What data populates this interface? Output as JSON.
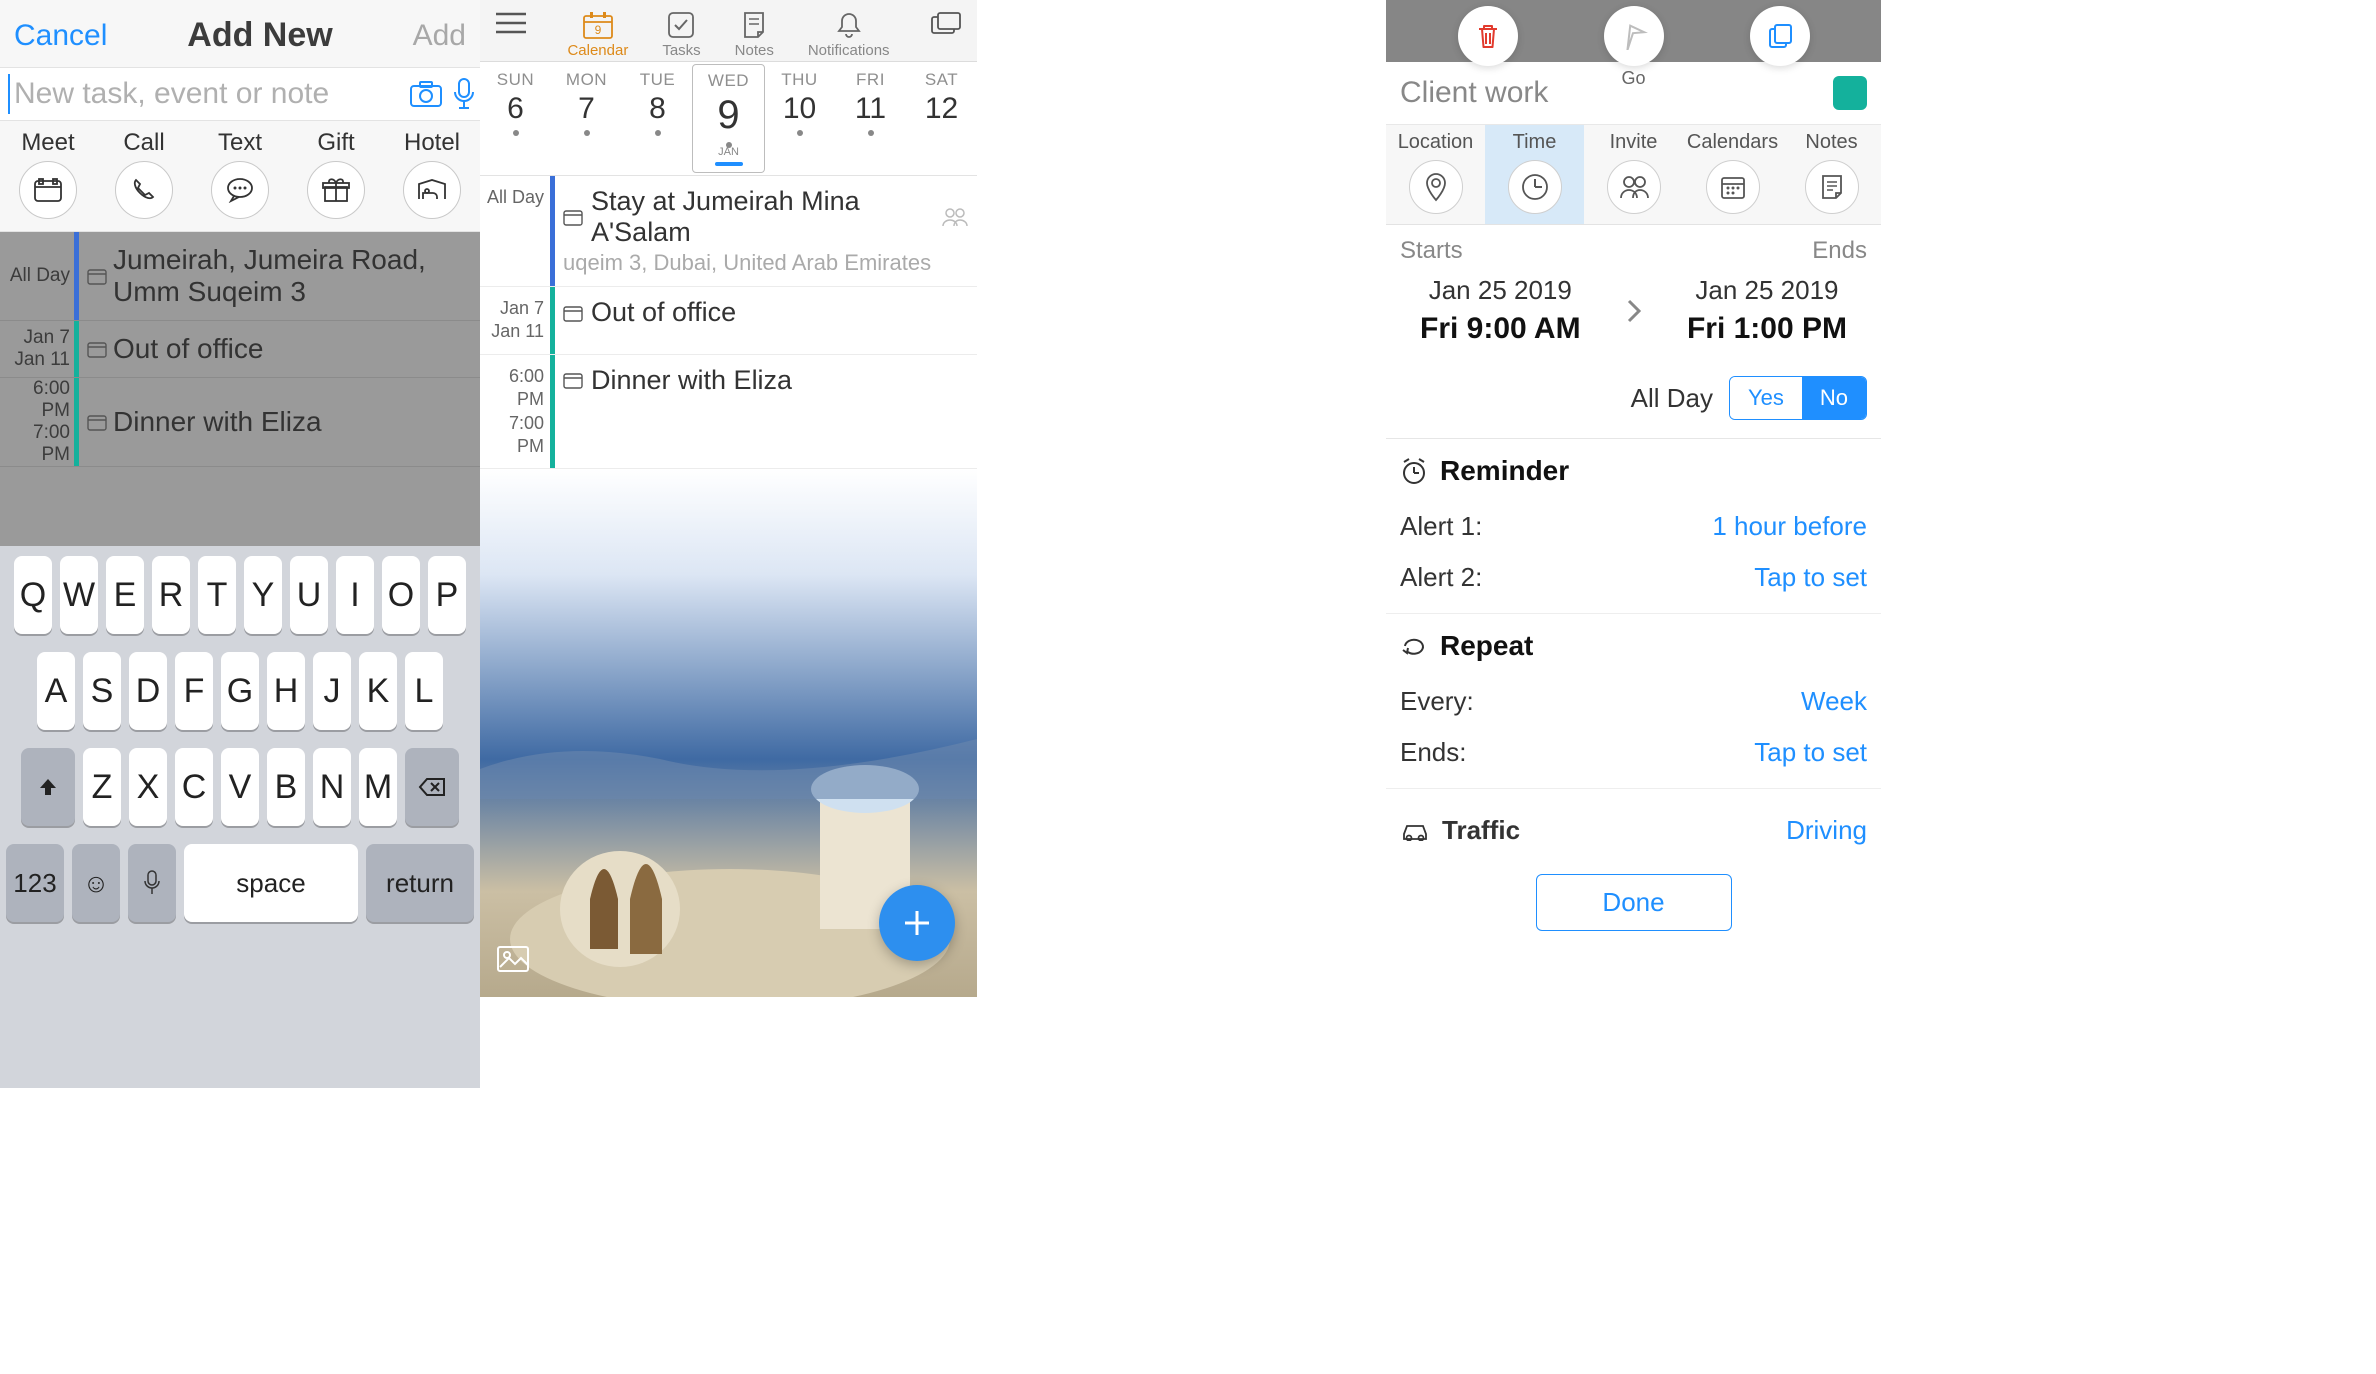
{
  "pane1": {
    "cancel": "Cancel",
    "title": "Add New",
    "add": "Add",
    "placeholder": "New task, event or note",
    "quick": [
      {
        "label": "Meet",
        "icon": "meet-icon"
      },
      {
        "label": "Call",
        "icon": "phone-icon"
      },
      {
        "label": "Text",
        "icon": "chat-icon"
      },
      {
        "label": "Gift",
        "icon": "gift-icon"
      },
      {
        "label": "Hotel",
        "icon": "hotel-icon"
      }
    ],
    "bg_events": [
      {
        "time_label": "All Day",
        "bar": "#3a6fd8",
        "title": "Jumeirah, Jumeira Road, Umm Suqeim 3"
      },
      {
        "time_top": "Jan 7",
        "time_bot": "Jan 11",
        "bar": "#14b19c",
        "title": "Out of office"
      },
      {
        "time_top": "6:00 PM",
        "time_bot": "7:00 PM",
        "bar": "#14b19c",
        "title": "Dinner with Eliza"
      }
    ],
    "keyboard": {
      "row1": [
        "Q",
        "W",
        "E",
        "R",
        "T",
        "Y",
        "U",
        "I",
        "O",
        "P"
      ],
      "row2": [
        "A",
        "S",
        "D",
        "F",
        "G",
        "H",
        "J",
        "K",
        "L"
      ],
      "row3": [
        "Z",
        "X",
        "C",
        "V",
        "B",
        "N",
        "M"
      ],
      "numbers": "123",
      "space": "space",
      "return": "return"
    }
  },
  "pane2": {
    "tabs": [
      {
        "label": "Calendar",
        "icon": "calendar-icon",
        "active": true,
        "badge": "9"
      },
      {
        "label": "Tasks",
        "icon": "check-icon"
      },
      {
        "label": "Notes",
        "icon": "note-icon"
      },
      {
        "label": "Notifications",
        "icon": "bell-icon"
      }
    ],
    "week": [
      {
        "name": "SUN",
        "num": "6",
        "dot": true
      },
      {
        "name": "MON",
        "num": "7",
        "dot": true
      },
      {
        "name": "TUE",
        "num": "8",
        "dot": true
      },
      {
        "name": "WED",
        "num": "9",
        "dot": true,
        "today": true,
        "month": "JAN"
      },
      {
        "name": "THU",
        "num": "10",
        "dot": true
      },
      {
        "name": "FRI",
        "num": "11",
        "dot": true
      },
      {
        "name": "SAT",
        "num": "12"
      }
    ],
    "events": [
      {
        "time": "All Day",
        "bar": "#3a6fd8",
        "title": "Stay at Jumeirah Mina A'Salam",
        "sub": "uqeim 3, Dubai, United Arab Emirates",
        "people": true
      },
      {
        "time_top": "Jan 7",
        "time_bot": "Jan 11",
        "bar": "#14b19c",
        "title": "Out of office"
      },
      {
        "time_top": "6:00 PM",
        "time_bot": "7:00 PM",
        "bar": "#14b19c",
        "title": "Dinner with Eliza"
      }
    ]
  },
  "pane3": {
    "go": "Go",
    "title": "Client work",
    "tabs": [
      {
        "label": "Location",
        "icon": "pin-icon"
      },
      {
        "label": "Time",
        "icon": "clock-icon",
        "active": true
      },
      {
        "label": "Invite",
        "icon": "people-icon"
      },
      {
        "label": "Calendars",
        "icon": "cal-icon"
      },
      {
        "label": "Notes",
        "icon": "note2-icon"
      }
    ],
    "starts": "Starts",
    "ends": "Ends",
    "start_date": "Jan 25 2019",
    "start_time": "Fri 9:00 AM",
    "end_date": "Jan 25 2019",
    "end_time": "Fri 1:00 PM",
    "allday_label": "All Day",
    "yes": "Yes",
    "no": "No",
    "reminder": "Reminder",
    "alerts": [
      {
        "k": "Alert 1:",
        "v": "1 hour before"
      },
      {
        "k": "Alert 2:",
        "v": "Tap to set"
      }
    ],
    "repeat": "Repeat",
    "repeats": [
      {
        "k": "Every:",
        "v": "Week"
      },
      {
        "k": "Ends:",
        "v": "Tap to set"
      }
    ],
    "traffic": "Traffic",
    "traffic_v": "Driving",
    "done": "Done"
  }
}
